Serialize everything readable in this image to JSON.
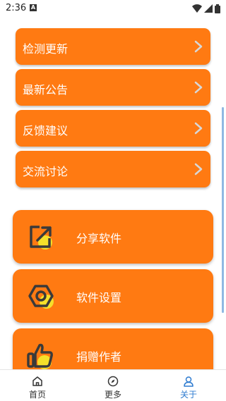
{
  "status": {
    "time": "2:36",
    "notif": "A"
  },
  "menu": [
    {
      "label": "检测更新"
    },
    {
      "label": "最新公告"
    },
    {
      "label": "反馈建议"
    },
    {
      "label": "交流讨论"
    }
  ],
  "cards": [
    {
      "label": "分享软件",
      "icon": "share-icon"
    },
    {
      "label": "软件设置",
      "icon": "settings-nut-icon"
    },
    {
      "label": "捐赠作者",
      "icon": "thumbs-up-icon"
    }
  ],
  "nav": {
    "home": "首页",
    "more": "更多",
    "about": "关于",
    "active": "about"
  },
  "colors": {
    "accent": "#ff7a12",
    "active_tab": "#2e7bd0",
    "icon_highlight": "#f5e02a"
  }
}
